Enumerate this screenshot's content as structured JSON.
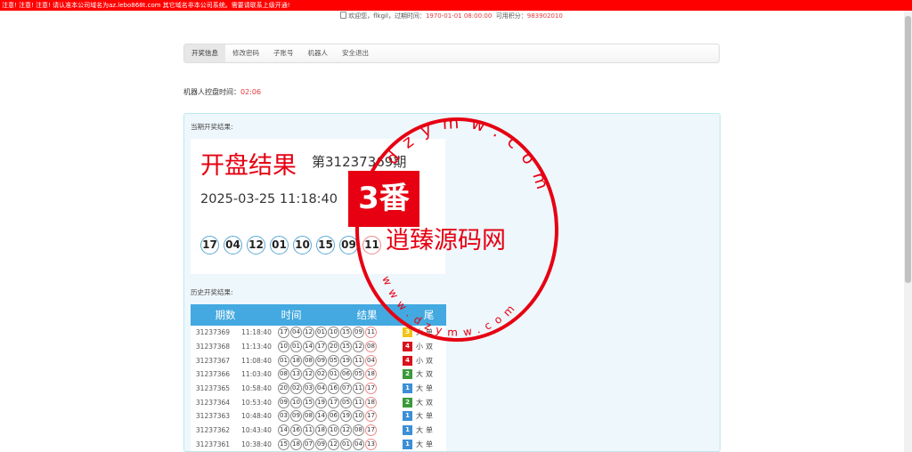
{
  "marquee": "注意! 注意! 注意! 请认准本公司域名为az.lebo868t.com 其它域名非本公司系统。需要请联系上级开通!",
  "welcome": {
    "prefix": "欢迎您，",
    "username": "flkgil",
    "expire_label": "过期时间：",
    "expire_value": "1970-01-01 08:00:00",
    "points_label": "可用积分：",
    "points_value": "983902010"
  },
  "nav": {
    "tabs": [
      {
        "label": "开奖信息"
      },
      {
        "label": "修改密码"
      },
      {
        "label": "子账号"
      },
      {
        "label": "机器人"
      },
      {
        "label": "安全退出"
      }
    ]
  },
  "timer": {
    "label": "机器人控盘时间：",
    "value": "02:06"
  },
  "current": {
    "section_title": "当期开奖结果:",
    "title": "开盘结果",
    "period": "第31237369期",
    "time": "2025-03-25 11:18:40",
    "balls": [
      "17",
      "04",
      "12",
      "01",
      "10",
      "15",
      "09",
      "11"
    ]
  },
  "history": {
    "section_title": "历史开奖结果:",
    "headers": [
      "期数",
      "时间",
      "结果",
      "尾"
    ],
    "rows": [
      {
        "period": "31237369",
        "time": "11:18:40",
        "balls": [
          "17",
          "04",
          "12",
          "01",
          "10",
          "15",
          "09",
          "11"
        ],
        "sum": "3",
        "size": "大",
        "parity": "单",
        "color": "#f0c419"
      },
      {
        "period": "31237368",
        "time": "11:13:40",
        "balls": [
          "10",
          "01",
          "14",
          "17",
          "20",
          "15",
          "12",
          "08"
        ],
        "sum": "4",
        "size": "小",
        "parity": "双",
        "color": "#d9121b"
      },
      {
        "period": "31237367",
        "time": "11:08:40",
        "balls": [
          "01",
          "18",
          "08",
          "09",
          "05",
          "19",
          "11",
          "04"
        ],
        "sum": "4",
        "size": "小",
        "parity": "双",
        "color": "#d9121b"
      },
      {
        "period": "31237366",
        "time": "11:03:40",
        "balls": [
          "08",
          "13",
          "12",
          "02",
          "01",
          "06",
          "05",
          "18"
        ],
        "sum": "2",
        "size": "大",
        "parity": "双",
        "color": "#3a9a3a"
      },
      {
        "period": "31237365",
        "time": "10:58:40",
        "balls": [
          "20",
          "02",
          "03",
          "04",
          "16",
          "07",
          "11",
          "17"
        ],
        "sum": "1",
        "size": "大",
        "parity": "单",
        "color": "#3c8fd6"
      },
      {
        "period": "31237364",
        "time": "10:53:40",
        "balls": [
          "09",
          "10",
          "15",
          "19",
          "17",
          "05",
          "11",
          "18"
        ],
        "sum": "2",
        "size": "大",
        "parity": "双",
        "color": "#3a9a3a"
      },
      {
        "period": "31237363",
        "time": "10:48:40",
        "balls": [
          "03",
          "09",
          "08",
          "14",
          "06",
          "19",
          "10",
          "17"
        ],
        "sum": "1",
        "size": "大",
        "parity": "单",
        "color": "#3c8fd6"
      },
      {
        "period": "31237362",
        "time": "10:43:40",
        "balls": [
          "14",
          "16",
          "11",
          "18",
          "10",
          "12",
          "08",
          "17"
        ],
        "sum": "1",
        "size": "大",
        "parity": "单",
        "color": "#3c8fd6"
      },
      {
        "period": "31237361",
        "time": "10:38:40",
        "balls": [
          "15",
          "18",
          "07",
          "09",
          "12",
          "01",
          "04",
          "13"
        ],
        "sum": "1",
        "size": "大",
        "parity": "单",
        "color": "#3c8fd6"
      }
    ]
  },
  "watermark": {
    "logo": "3番",
    "text": "逍臻源码网",
    "ring_top": "dzymw.com",
    "ring_bottom": "www.dzymw.com"
  }
}
